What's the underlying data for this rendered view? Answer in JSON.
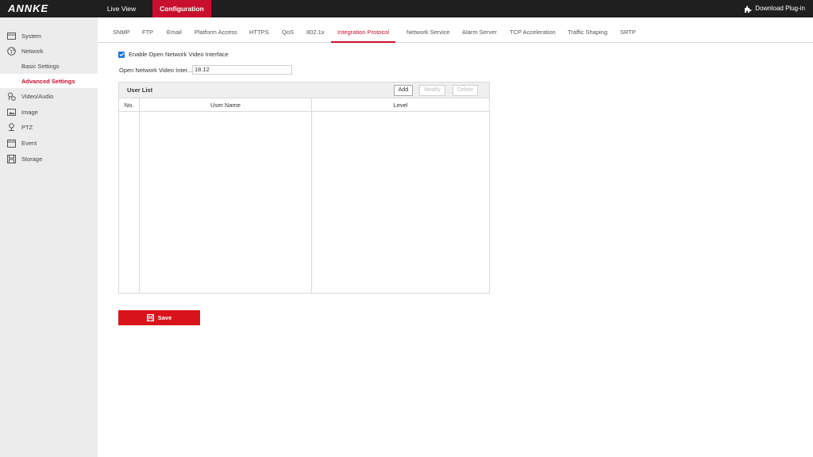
{
  "header": {
    "logo": "ANNKE",
    "nav": {
      "live_view": "Live View",
      "configuration": "Configuration"
    },
    "download": "Download Plug-in"
  },
  "sidebar": {
    "items": [
      {
        "label": "System",
        "icon": "system-icon"
      },
      {
        "label": "Network",
        "icon": "globe-icon"
      },
      {
        "label": "Basic Settings",
        "sub": true
      },
      {
        "label": "Advanced Settings",
        "sub": true,
        "active": true
      },
      {
        "label": "Video/Audio",
        "icon": "video-audio-icon"
      },
      {
        "label": "Image",
        "icon": "image-icon"
      },
      {
        "label": "PTZ",
        "icon": "ptz-icon"
      },
      {
        "label": "Event",
        "icon": "event-icon"
      },
      {
        "label": "Storage",
        "icon": "storage-icon"
      }
    ]
  },
  "tabs": [
    {
      "label": "SNMP"
    },
    {
      "label": "FTP"
    },
    {
      "label": "Email"
    },
    {
      "label": "Platform Access"
    },
    {
      "label": "HTTPS"
    },
    {
      "label": "QoS"
    },
    {
      "label": "802.1x"
    },
    {
      "label": "Integration Protocol",
      "active": true
    },
    {
      "label": "Network Service"
    },
    {
      "label": "Alarm Server"
    },
    {
      "label": "TCP Acceleration"
    },
    {
      "label": "Traffic Shaping"
    },
    {
      "label": "SRTP"
    }
  ],
  "form": {
    "enable_label": "Enable Open Network Video Interface",
    "enable_checked": true,
    "version_label": "Open Network Video Inter...",
    "version_value": "18.12"
  },
  "user_list": {
    "title": "User List",
    "buttons": {
      "add": "Add",
      "modify": "Modify",
      "delete": "Delete"
    },
    "columns": [
      "No.",
      "User Name",
      "Level"
    ],
    "rows": []
  },
  "save_label": "Save",
  "colors": {
    "accent": "#c8102e",
    "topbar": "#1f1f1f",
    "sidebar": "#ececec",
    "checkbox": "#1a73e8"
  }
}
